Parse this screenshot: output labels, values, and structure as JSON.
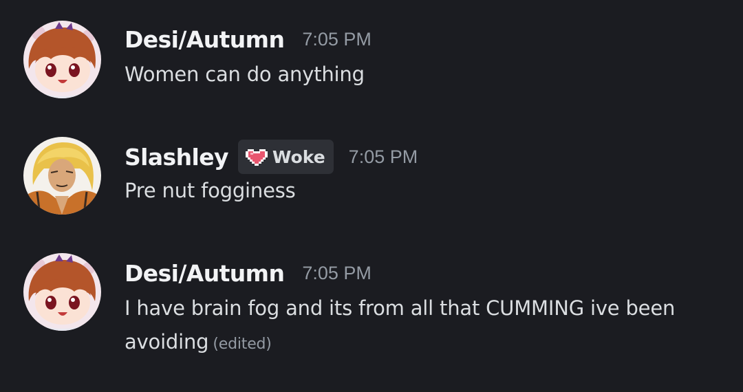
{
  "messages": [
    {
      "username": "Desi/Autumn",
      "timestamp": "7:05 PM",
      "text": "Women can do anything",
      "avatar_icon": "anime-avatar-icon"
    },
    {
      "username": "Slashley",
      "role_tag": {
        "label": "Woke",
        "icon": "pixel-heart-icon",
        "color": "#e8566f"
      },
      "timestamp": "7:05 PM",
      "text": "Pre nut fogginess",
      "avatar_icon": "anime-avatar-icon"
    },
    {
      "username": "Desi/Autumn",
      "timestamp": "7:05 PM",
      "text": "I have brain fog and its from all that CUMMING ive been avoiding",
      "edited_label": "(edited)",
      "avatar_icon": "anime-avatar-icon"
    }
  ],
  "colors": {
    "background": "#1b1c21",
    "username": "#f2f3f5",
    "text": "#dbdee1",
    "muted": "#949ba4",
    "role_tag_bg": "#2e3036"
  }
}
